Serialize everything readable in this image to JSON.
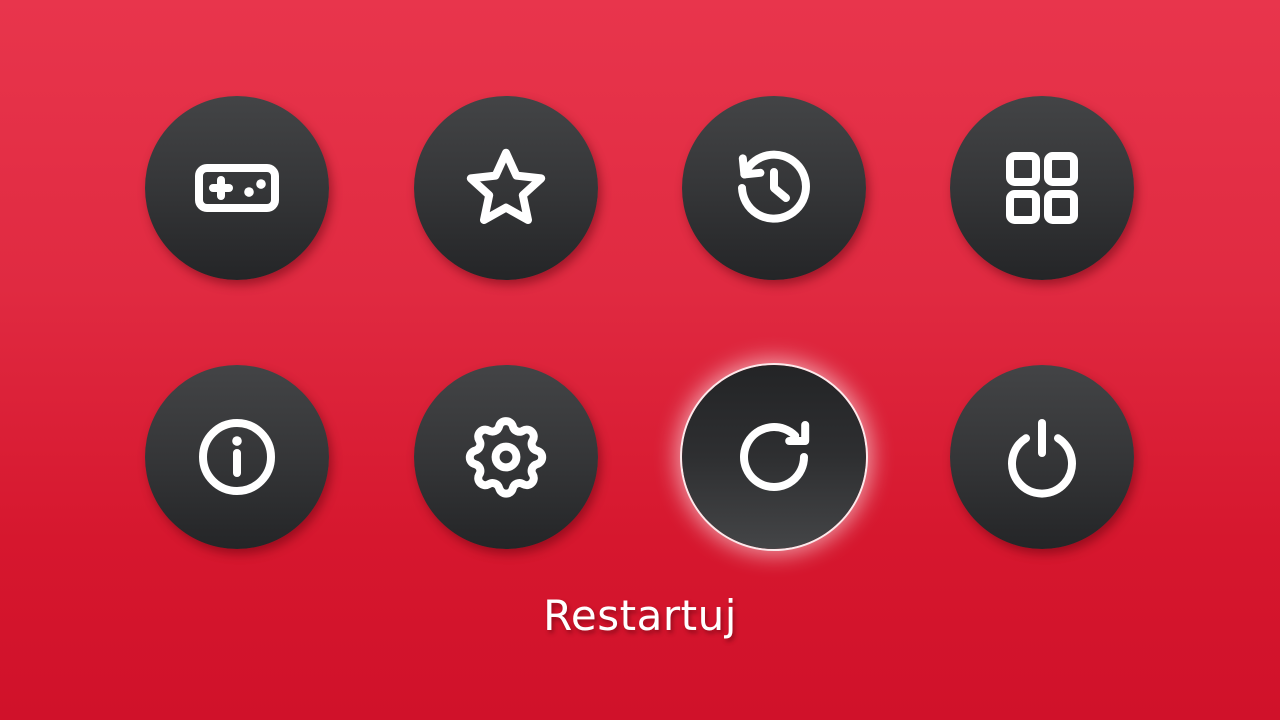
{
  "theme": {
    "background_top": "#e8354c",
    "background_bottom": "#d0112a",
    "button_color": "#353638",
    "icon_color": "#ffffff"
  },
  "menu": {
    "items": [
      {
        "icon": "gamepad-icon",
        "selected": false
      },
      {
        "icon": "star-icon",
        "selected": false
      },
      {
        "icon": "history-icon",
        "selected": false
      },
      {
        "icon": "grid-icon",
        "selected": false
      },
      {
        "icon": "info-icon",
        "selected": false
      },
      {
        "icon": "gear-icon",
        "selected": false
      },
      {
        "icon": "restart-icon",
        "selected": true
      },
      {
        "icon": "power-icon",
        "selected": false
      }
    ],
    "selected_label": "Restartuj"
  }
}
